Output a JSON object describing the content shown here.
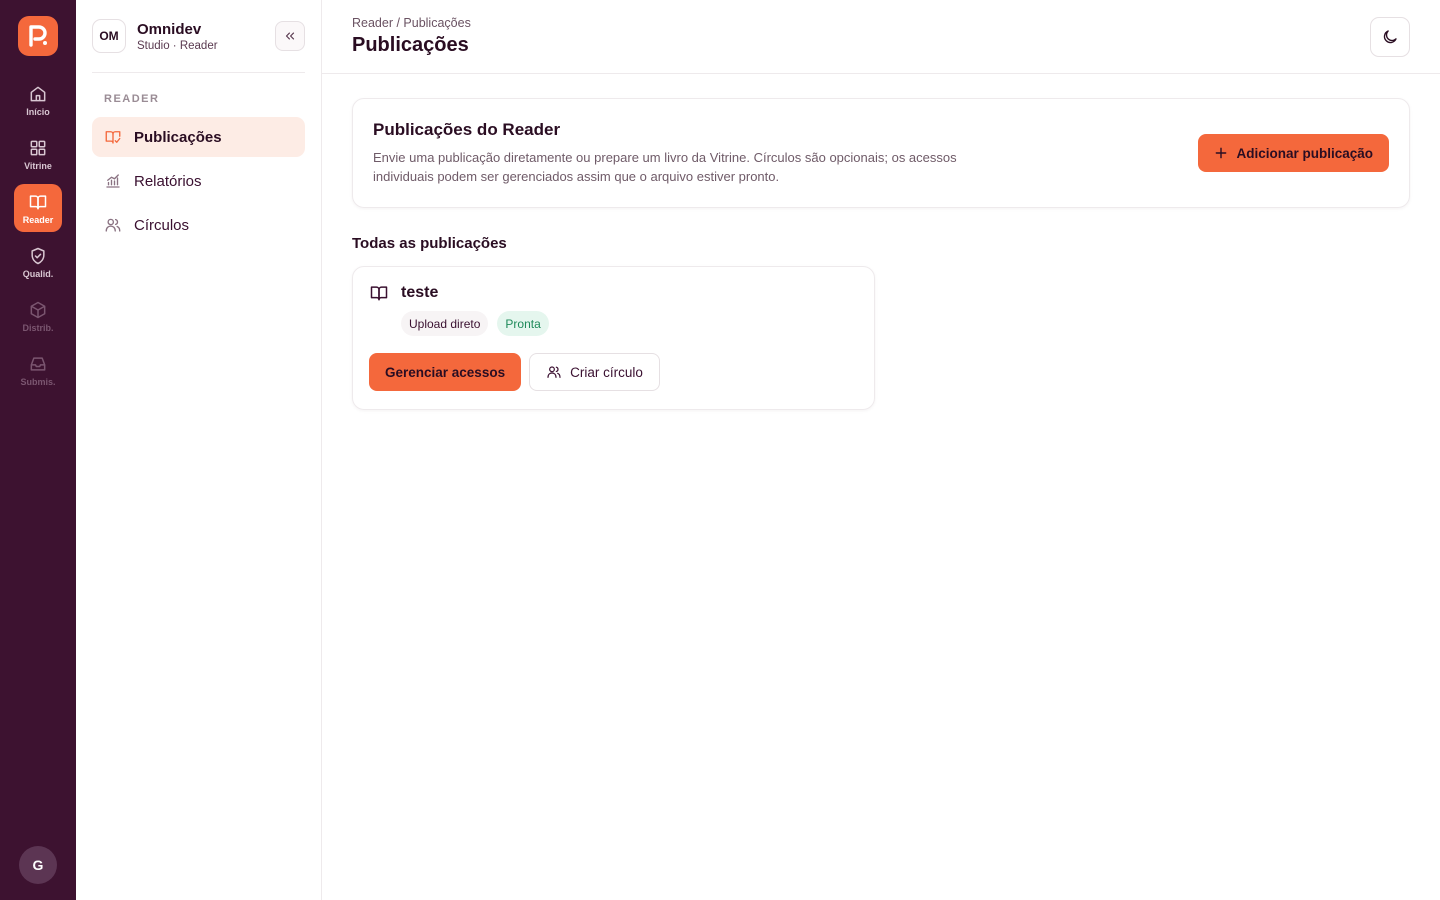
{
  "rail": {
    "items": [
      {
        "label": "Início",
        "icon": "home-icon"
      },
      {
        "label": "Vitrine",
        "icon": "grid-icon"
      },
      {
        "label": "Reader",
        "icon": "book-open-icon"
      },
      {
        "label": "Qualid.",
        "icon": "shield-check-icon"
      },
      {
        "label": "Distrib.",
        "icon": "box-icon"
      },
      {
        "label": "Submis.",
        "icon": "inbox-icon"
      }
    ],
    "active": "Reader",
    "avatar_initial": "G"
  },
  "org": {
    "badge": "OM",
    "name": "Omnidev",
    "subtitle": "Studio · Reader"
  },
  "sidebar": {
    "section_label": "READER",
    "items": [
      {
        "label": "Publicações",
        "icon": "book-edit-icon",
        "active": true
      },
      {
        "label": "Relatórios",
        "icon": "chart-icon",
        "active": false
      },
      {
        "label": "Círculos",
        "icon": "users-icon",
        "active": false
      }
    ]
  },
  "header": {
    "breadcrumb": "Reader / Publicações",
    "title": "Publicações",
    "theme_icon": "moon-icon"
  },
  "hero": {
    "title": "Publicações do Reader",
    "description": "Envie uma publicação diretamente ou prepare um livro da Vitrine. Círculos são opcionais; os acessos individuais podem ser gerenciados assim que o arquivo estiver pronto.",
    "add_button": "Adicionar publicação"
  },
  "publications": {
    "section_title": "Todas as publicações",
    "items": [
      {
        "title": "teste",
        "source_tag": "Upload direto",
        "status_tag": "Pronta",
        "primary_action": "Gerenciar acessos",
        "secondary_action": "Criar círculo"
      }
    ]
  },
  "colors": {
    "rail_bg": "#3d1230",
    "accent": "#f4683c",
    "text_dark": "#2a0d22",
    "status_ready_bg": "#e5f6ee",
    "status_ready_text": "#1f8a5a"
  }
}
